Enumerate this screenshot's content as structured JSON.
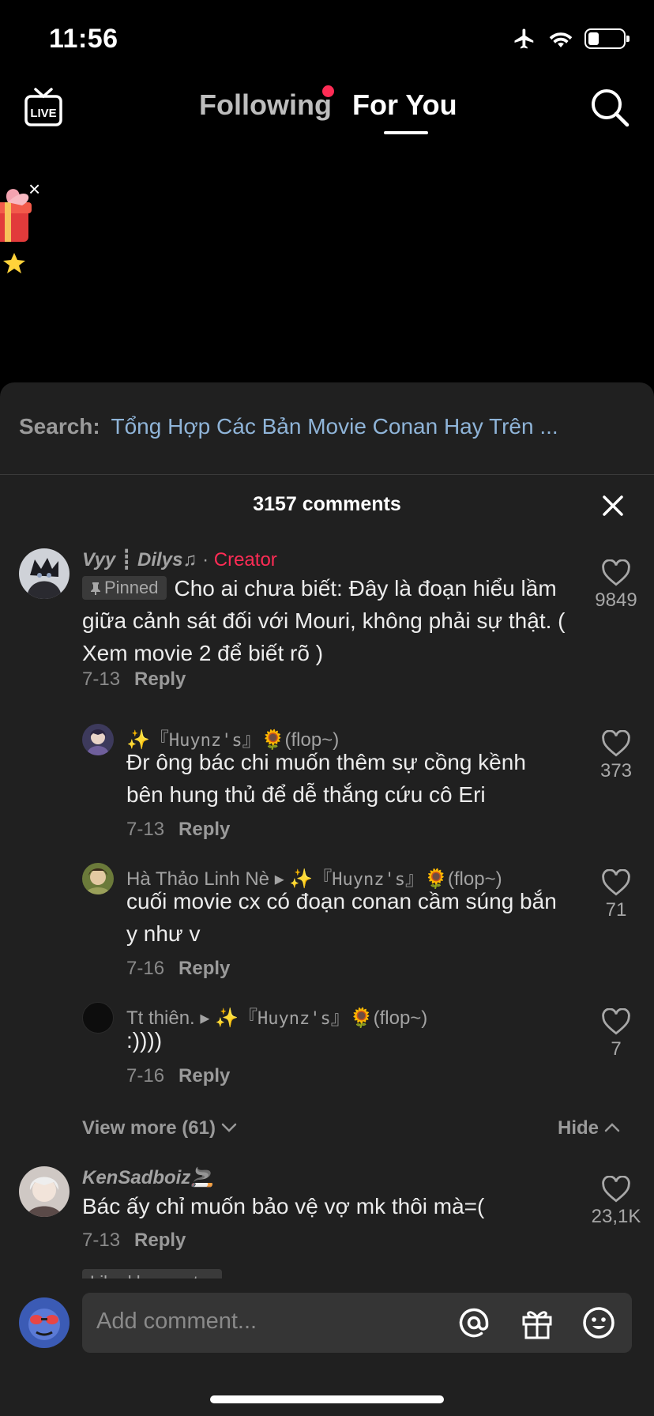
{
  "status_bar": {
    "time": "11:56",
    "battery_level": 0.3
  },
  "top_nav": {
    "live_label": "LIVE",
    "tabs": [
      {
        "label": "Following",
        "has_notification_dot": true
      },
      {
        "label": "For You",
        "active": true
      }
    ]
  },
  "sheet": {
    "search_label": "Search:",
    "search_query": "Tổng Hợp Các Bản Movie Conan Hay Trên ...",
    "comment_count": "3157 comments",
    "comments": [
      {
        "author": "Vyy ┋ Dilys♫",
        "separator": " · ",
        "badge": "Creator",
        "pinned_label": "Pinned",
        "text": "Cho ai chưa biết: Đây là đoạn hiểu lầm giữa cảnh sát đối với Mouri, không phải sự thật. ( Xem movie 2 để biết rõ )",
        "date": "7-13",
        "reply_label": "Reply",
        "likes": "9849"
      },
      {
        "author_prefix": "✨『",
        "author_mid": "Huynz's",
        "author_suffix": "』🌻(flop~)",
        "text": "Đr ông bác chi muốn thêm sự cồng kềnh bên hung thủ để dễ thắng cứu cô Eri",
        "date": "7-13",
        "reply_label": "Reply",
        "likes": "373"
      },
      {
        "author": "Hà Thảo Linh Nè",
        "reply_to_prefix": "✨『",
        "reply_to_mid": "Huynz's",
        "reply_to_suffix": "』🌻(flop~)",
        "text": "cuối movie cx có đoạn conan cầm súng bắn y như v",
        "date": "7-16",
        "reply_label": "Reply",
        "likes": "71"
      },
      {
        "author": "Tt thiên.",
        "reply_to_prefix": "✨『",
        "reply_to_mid": "Huynz's",
        "reply_to_suffix": "』🌻(flop~)",
        "text": ":))))",
        "date": "7-16",
        "reply_label": "Reply",
        "likes": "7"
      },
      {
        "author": "KenSadboiz🚬",
        "text": "Bác ấy chỉ muốn bảo vệ vợ mk thôi mà=(",
        "date": "7-13",
        "reply_label": "Reply",
        "likes": "23,1K",
        "liked_by": "Liked by creator"
      }
    ],
    "view_more_label": "View more (61)",
    "hide_label": "Hide"
  },
  "input": {
    "placeholder": "Add comment..."
  },
  "colors": {
    "accent": "#fe2c55",
    "sheet_bg": "#202020",
    "link": "#8fb4d8"
  }
}
